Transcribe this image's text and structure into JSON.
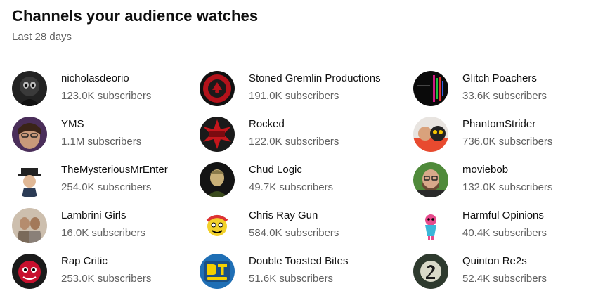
{
  "header": {
    "title": "Channels your audience watches",
    "subtitle": "Last 28 days"
  },
  "channels": [
    {
      "name": "nicholasdeorio",
      "subscribers": "123.0K subscribers",
      "avatar_icon": "dark-creature-avatar",
      "avatar_color": "#1c1c1c"
    },
    {
      "name": "Stoned Gremlin Productions",
      "subscribers": "191.0K subscribers",
      "avatar_icon": "red-seal-avatar",
      "avatar_color": "#b3121b"
    },
    {
      "name": "Glitch Poachers",
      "subscribers": "33.6K subscribers",
      "avatar_icon": "glitch-avatar",
      "avatar_color": "#0d0d0d"
    },
    {
      "name": "YMS",
      "subscribers": "1.1M subscribers",
      "avatar_icon": "face-photo-avatar",
      "avatar_color": "#6b4c3a"
    },
    {
      "name": "Rocked",
      "subscribers": "122.0K subscribers",
      "avatar_icon": "red-burst-avatar",
      "avatar_color": "#c4161c"
    },
    {
      "name": "PhantomStrider",
      "subscribers": "736.0K subscribers",
      "avatar_icon": "cartoon-faces-avatar",
      "avatar_color": "#e84a2f"
    },
    {
      "name": "TheMysteriousMrEnter",
      "subscribers": "254.0K subscribers",
      "avatar_icon": "hat-character-avatar",
      "avatar_color": "#2b3b55"
    },
    {
      "name": "Chud Logic",
      "subscribers": "49.7K subscribers",
      "avatar_icon": "portrait-avatar",
      "avatar_color": "#3a4a1c"
    },
    {
      "name": "moviebob",
      "subscribers": "132.0K subscribers",
      "avatar_icon": "bearded-man-avatar",
      "avatar_color": "#4f8a3a"
    },
    {
      "name": "Lambrini Girls",
      "subscribers": "16.0K subscribers",
      "avatar_icon": "band-photo-avatar",
      "avatar_color": "#c9b9a4"
    },
    {
      "name": "Chris Ray Gun",
      "subscribers": "584.0K subscribers",
      "avatar_icon": "cartoon-yellow-avatar",
      "avatar_color": "#f2d12b"
    },
    {
      "name": "Harmful Opinions",
      "subscribers": "40.4K subscribers",
      "avatar_icon": "colorful-figure-avatar",
      "avatar_color": "#e64a8b"
    },
    {
      "name": "Rap Critic",
      "subscribers": "253.0K subscribers",
      "avatar_icon": "red-character-avatar",
      "avatar_color": "#c8102e"
    },
    {
      "name": "Double Toasted Bites",
      "subscribers": "51.6K subscribers",
      "avatar_icon": "dt-bites-logo-avatar",
      "avatar_color": "#1f6fb5"
    },
    {
      "name": "Quinton Re2s",
      "subscribers": "52.4K subscribers",
      "avatar_icon": "number-two-avatar",
      "avatar_color": "#3c4e3c"
    }
  ]
}
